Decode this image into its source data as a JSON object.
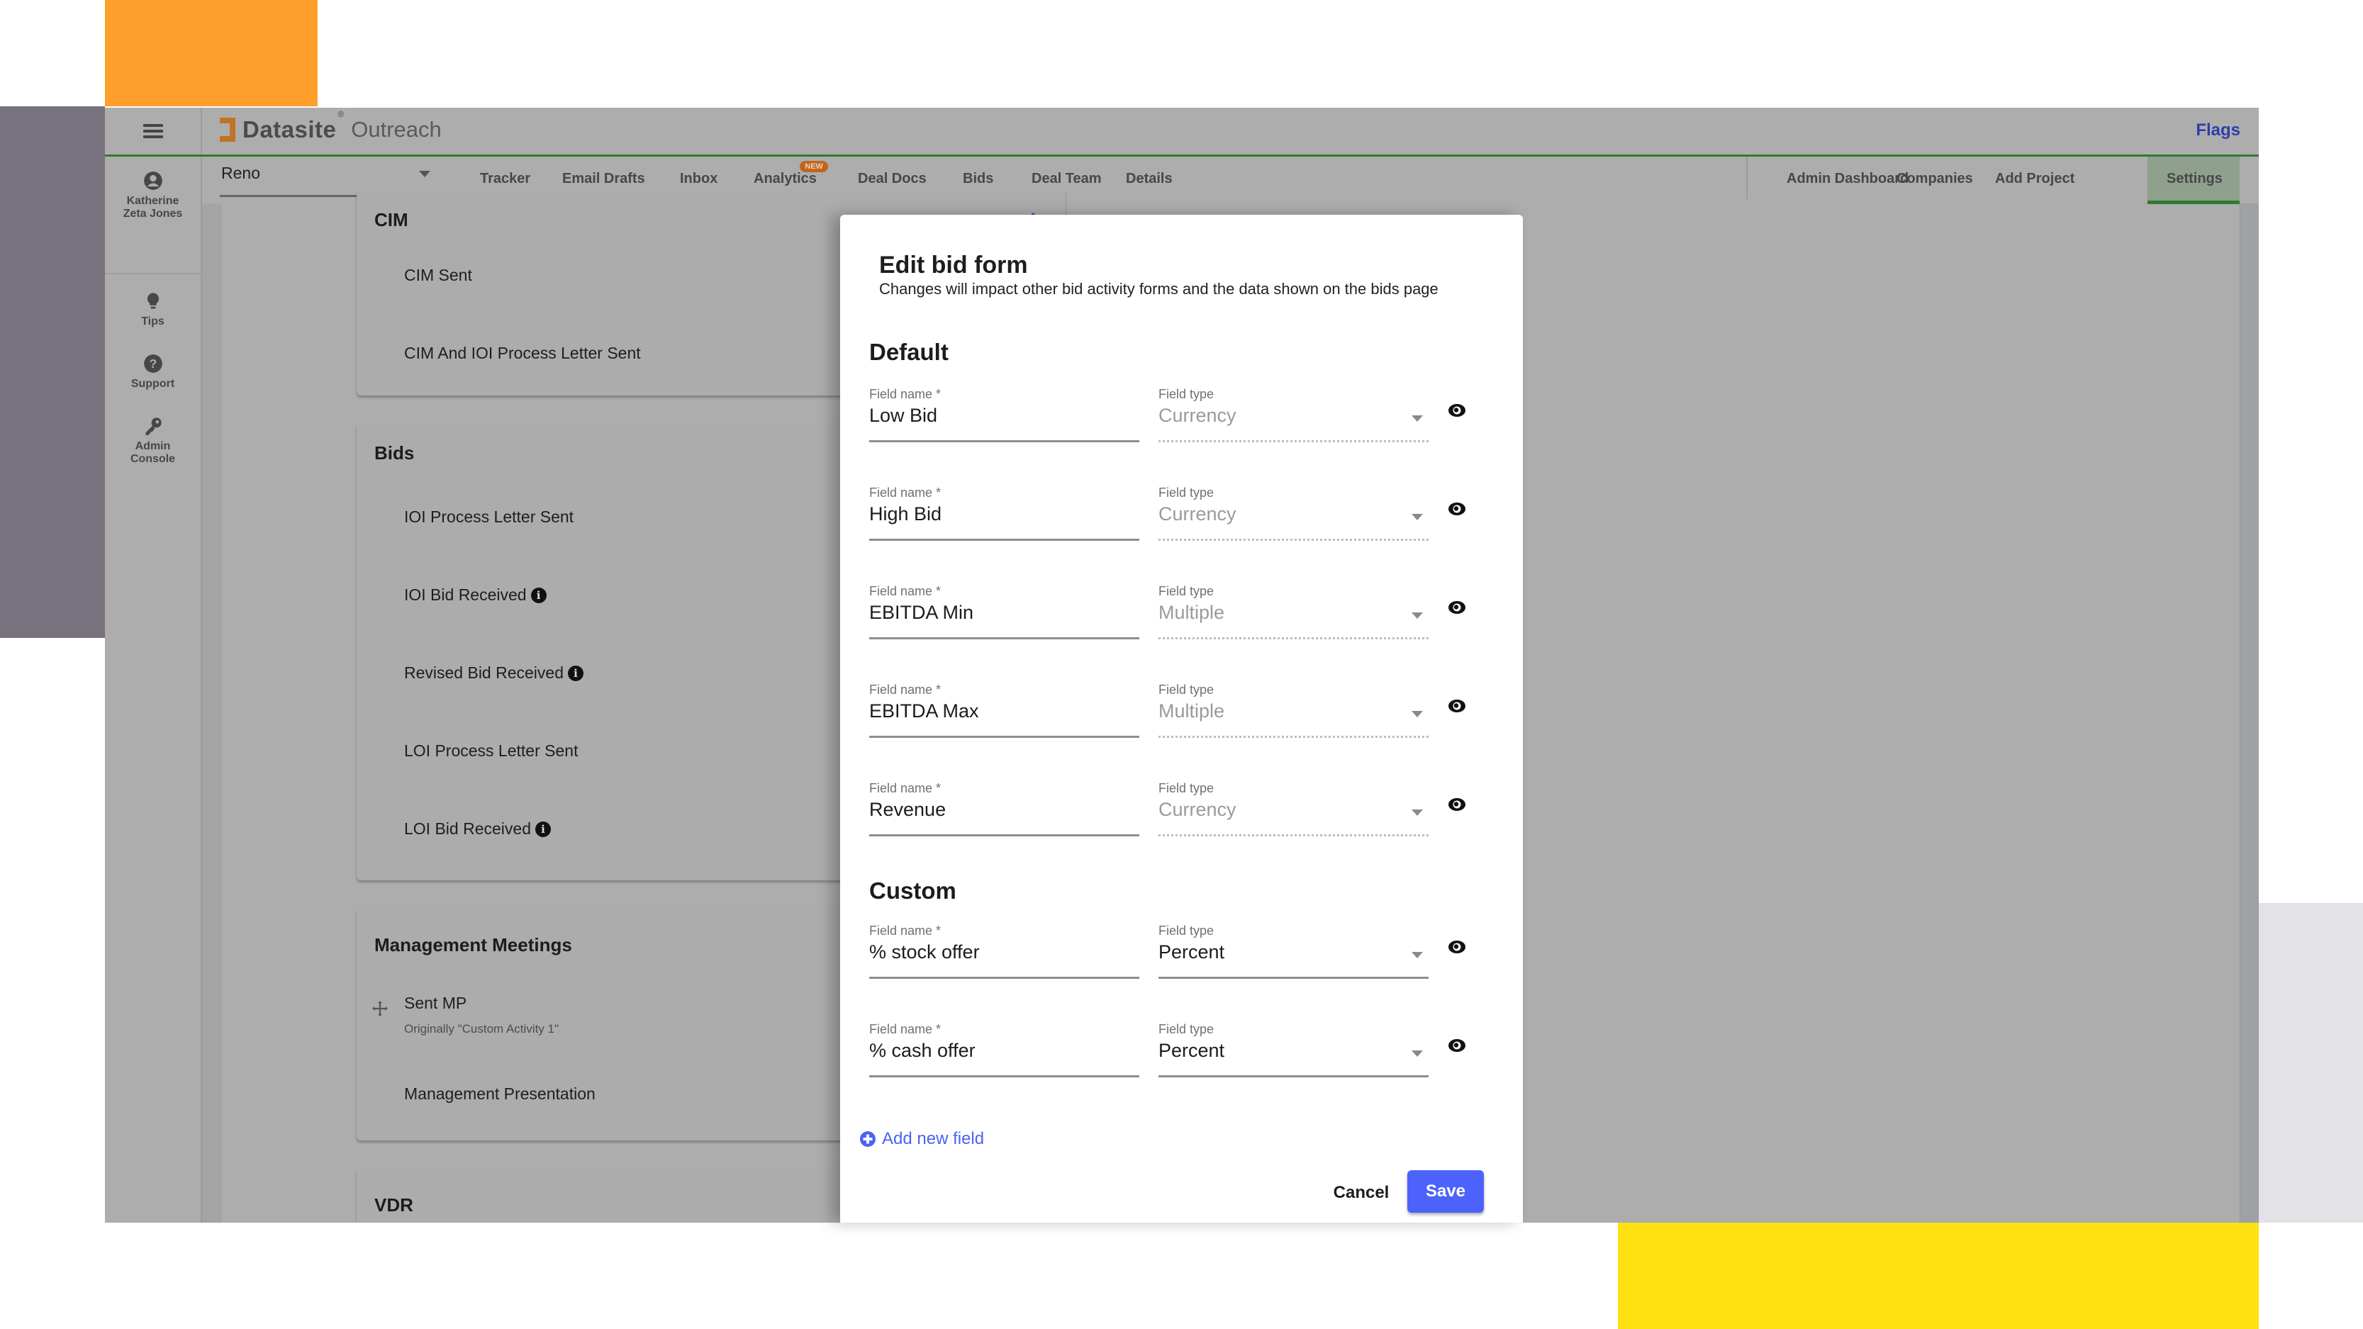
{
  "decor": {
    "colors": {
      "orange": "#fd9f2a",
      "purple": "#78727e",
      "yellow": "#fee113",
      "light_gray": "#e3e2e7"
    }
  },
  "header": {
    "brand": "Datasite",
    "brand_mark": "®",
    "product": "Outreach",
    "flags_link": "Flags"
  },
  "nav": {
    "project_select": {
      "value": "Reno"
    },
    "tabs": [
      {
        "label": "Tracker"
      },
      {
        "label": "Email Drafts"
      },
      {
        "label": "Inbox"
      },
      {
        "label": "Analytics",
        "badge": "NEW"
      },
      {
        "label": "Deal Docs"
      },
      {
        "label": "Bids"
      },
      {
        "label": "Deal Team"
      },
      {
        "label": "Details"
      }
    ],
    "right_tabs": [
      {
        "label": "Admin Dashboard"
      },
      {
        "label": "Companies"
      },
      {
        "label": "Add Project"
      },
      {
        "label": "Settings",
        "active": true
      }
    ]
  },
  "rail": {
    "user": {
      "name_line1": "Katherine",
      "name_line2": "Zeta Jones",
      "icon": "account-circle-icon"
    },
    "items": [
      {
        "label": "Tips",
        "icon": "lightbulb-icon"
      },
      {
        "label": "Support",
        "icon": "help-circle-icon"
      },
      {
        "label_line1": "Admin",
        "label_line2": "Console",
        "icon": "key-icon"
      }
    ]
  },
  "activities": {
    "groups": [
      {
        "title": "CIM",
        "items": [
          {
            "label": "CIM Sent"
          },
          {
            "label": "CIM And IOI Process Letter Sent"
          }
        ]
      },
      {
        "title": "Bids",
        "items": [
          {
            "label": "IOI Process Letter Sent",
            "info": false
          },
          {
            "label": "IOI Bid Received",
            "info": true
          },
          {
            "label": "Revised Bid Received",
            "info": true
          },
          {
            "label": "LOI Process Letter Sent",
            "info": false
          },
          {
            "label": "LOI Bid Received",
            "info": true
          }
        ]
      },
      {
        "title": "Management Meetings",
        "items": [
          {
            "label": "Sent MP",
            "subtitle": "Originally \"Custom Activity 1\""
          },
          {
            "label": "Management Presentation"
          }
        ]
      },
      {
        "title": "VDR",
        "items": []
      }
    ]
  },
  "modal": {
    "title": "Edit bid form",
    "subtitle": "Changes will impact other bid activity forms and the data shown on the bids page",
    "field_name_label": "Field name *",
    "field_type_label": "Field type",
    "default_section": {
      "title": "Default",
      "fields": [
        {
          "name": "Low Bid",
          "type": "Currency",
          "type_editable": false
        },
        {
          "name": "High Bid",
          "type": "Currency",
          "type_editable": false
        },
        {
          "name": "EBITDA Min",
          "type": "Multiple",
          "type_editable": false
        },
        {
          "name": "EBITDA Max",
          "type": "Multiple",
          "type_editable": false
        },
        {
          "name": "Revenue",
          "type": "Currency",
          "type_editable": false
        }
      ]
    },
    "custom_section": {
      "title": "Custom",
      "fields": [
        {
          "name": "% stock offer",
          "type": "Percent",
          "type_editable": true
        },
        {
          "name": "% cash offer",
          "type": "Percent",
          "type_editable": true
        }
      ]
    },
    "add_field_label": "Add new field",
    "cancel_label": "Cancel",
    "save_label": "Save",
    "accent_color": "#4d62fb"
  }
}
